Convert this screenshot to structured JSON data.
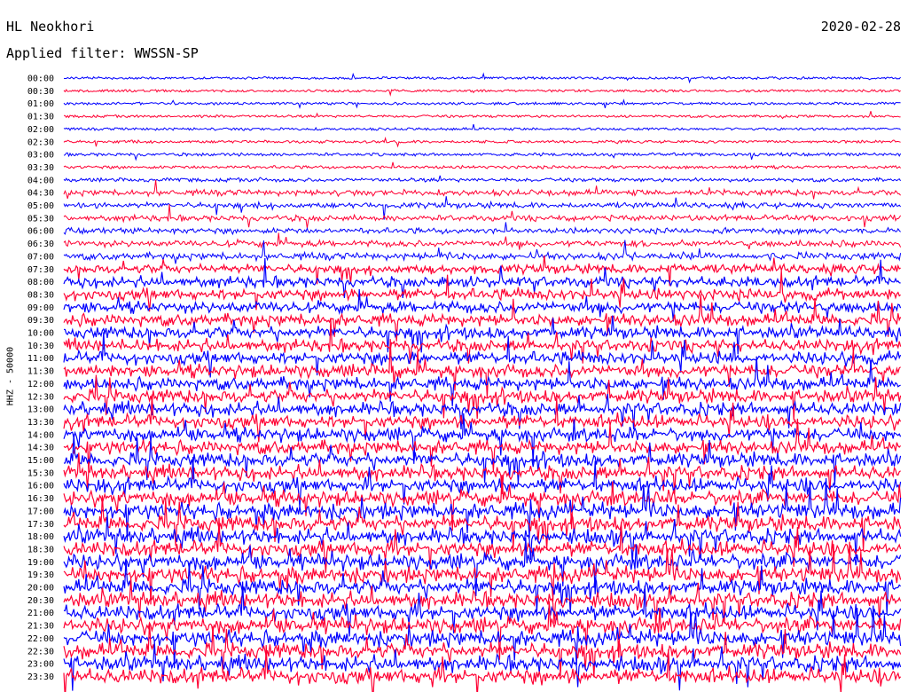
{
  "header": {
    "station": "HL Neokhori",
    "filter": "Applied filter: WWSSN-SP",
    "date": "2020-02-28"
  },
  "axis": {
    "ylabel": "HHZ - 50000"
  },
  "colors": {
    "trace_a": "#0000ff",
    "trace_b": "#ff0033",
    "background": "#ffffff"
  },
  "chart_data": {
    "type": "line",
    "title": "HL Neokhori",
    "xlabel": "",
    "ylabel": "HHZ - 50000",
    "row_labels": [
      "00:00",
      "00:30",
      "01:00",
      "01:30",
      "02:00",
      "02:30",
      "03:00",
      "03:30",
      "04:00",
      "04:30",
      "05:00",
      "05:30",
      "06:00",
      "06:30",
      "07:00",
      "07:30",
      "08:00",
      "08:30",
      "09:00",
      "09:30",
      "10:00",
      "10:30",
      "11:00",
      "11:30",
      "12:00",
      "12:30",
      "13:00",
      "13:30",
      "14:00",
      "14:30",
      "15:00",
      "15:30",
      "16:00",
      "16:30",
      "17:00",
      "17:30",
      "18:00",
      "18:30",
      "19:00",
      "19:30",
      "20:00",
      "20:30",
      "21:00",
      "21:30",
      "22:00",
      "22:30",
      "23:00",
      "23:30"
    ],
    "row_colors": [
      "blue",
      "red"
    ],
    "activity_level": [
      0.05,
      0.05,
      0.06,
      0.06,
      0.06,
      0.08,
      0.1,
      0.1,
      0.15,
      0.3,
      0.3,
      0.3,
      0.3,
      0.35,
      0.4,
      0.55,
      0.65,
      0.7,
      0.7,
      0.75,
      0.75,
      0.75,
      0.8,
      0.8,
      0.8,
      0.85,
      0.85,
      0.85,
      0.85,
      0.85,
      0.9,
      0.9,
      0.9,
      0.95,
      1,
      1,
      1,
      1,
      1,
      1,
      1,
      1,
      1,
      1,
      1,
      1,
      1,
      1
    ]
  }
}
